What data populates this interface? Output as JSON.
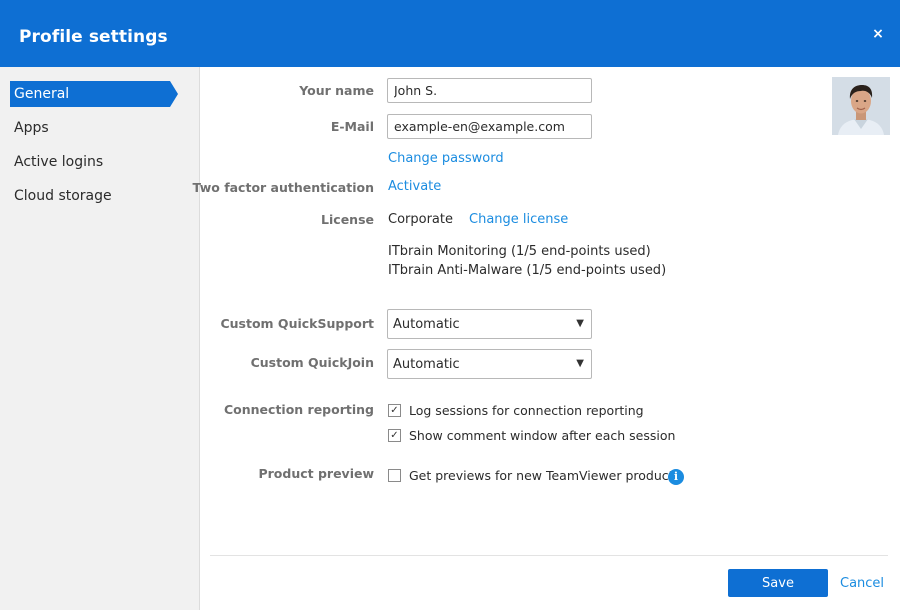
{
  "window": {
    "title": "Profile settings",
    "close_label": "×"
  },
  "sidebar": {
    "items": [
      {
        "label": "General",
        "active": true
      },
      {
        "label": "Apps",
        "active": false
      },
      {
        "label": "Active logins",
        "active": false
      },
      {
        "label": "Cloud storage",
        "active": false
      }
    ]
  },
  "form": {
    "name": {
      "label": "Your name",
      "value": "John S."
    },
    "email": {
      "label": "E-Mail",
      "value": "example-en@example.com"
    },
    "change_password": "Change password",
    "two_factor": {
      "label": "Two factor authentication",
      "link": "Activate"
    },
    "license": {
      "label": "License",
      "value": "Corporate",
      "change_link": "Change license",
      "addons": [
        "ITbrain Monitoring (1/5 end-points used)",
        "ITbrain Anti-Malware (1/5 end-points used)"
      ]
    },
    "quicksupport": {
      "label": "Custom QuickSupport",
      "value": "Automatic"
    },
    "quickjoin": {
      "label": "Custom QuickJoin",
      "value": "Automatic"
    },
    "connection_reporting": {
      "label": "Connection reporting",
      "options": [
        {
          "label": "Log sessions for connection reporting",
          "checked": true
        },
        {
          "label": "Show comment window after each session",
          "checked": true
        }
      ]
    },
    "product_preview": {
      "label": "Product preview",
      "option": {
        "label": "Get previews for new TeamViewer products",
        "checked": false
      },
      "info_icon": "info-icon"
    }
  },
  "footer": {
    "save_label": "Save",
    "cancel_label": "Cancel"
  },
  "colors": {
    "brand": "#0e6fd3",
    "link": "#1b8ce0",
    "label_gray": "#707070",
    "sidebar_bg": "#f1f1f1"
  }
}
